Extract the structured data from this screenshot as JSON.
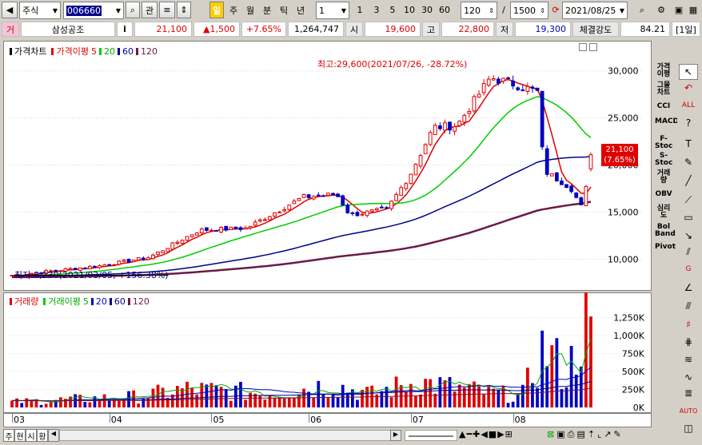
{
  "toolbar": {
    "market": "주식",
    "code": "006660",
    "btn_gwan": "관",
    "period_day": "일",
    "period_week": "주",
    "period_month": "월",
    "period_min": "분",
    "period_tick": "틱",
    "period_year": "년",
    "interval": "1",
    "quick_1": "1",
    "quick_3": "3",
    "quick_5": "5",
    "quick_10": "10",
    "quick_30": "30",
    "quick_60": "60",
    "count": "120",
    "slash": "/",
    "total": "1500",
    "date": "2021/08/25"
  },
  "quote": {
    "tag": "거",
    "name": "삼성공조",
    "info": "i",
    "price": "21,100",
    "change": "▲1,500",
    "rate": "+7.65%",
    "volume": "1,264,747",
    "open_label": "시",
    "open": "19,600",
    "high_label": "고",
    "high": "22,800",
    "low_label": "저",
    "low": "19,300",
    "strength_label": "체결강도",
    "strength": "84.21",
    "period_badge": "[1일]"
  },
  "price_legend": {
    "price": "가격차트",
    "ma_label": "가격이평",
    "ma5": "5",
    "ma20": "20",
    "ma60": "60",
    "ma120": "120"
  },
  "volume_legend": {
    "volume": "거래량",
    "ma_label": "거래이평",
    "ma5": "5",
    "ma20": "20",
    "ma60": "60",
    "ma120": "120"
  },
  "annotations": {
    "high": "최고:29,600(2021/07/26, -28.72%)",
    "low": "최저:8,230(2021/03/05, +156.38%)",
    "current_price": "21,100",
    "current_rate": "(7.65%)"
  },
  "price_axis": [
    "30,000",
    "25,000",
    "20,000",
    "15,000",
    "10,000"
  ],
  "volume_axis": [
    "1,250K",
    "1,000K",
    "750K",
    "500K",
    "250K",
    "0K"
  ],
  "months": [
    "03",
    "04",
    "05",
    "06",
    "07",
    "08"
  ],
  "indicators": [
    "가격이평",
    "그물차트",
    "CCI",
    "MACD",
    "F-Stoc",
    "S-Stoc",
    "거래량",
    "OBV",
    "심리도",
    "Bol Band",
    "Pivot"
  ],
  "bottom_tabs": [
    "주",
    "현",
    "시",
    "황"
  ],
  "colors": {
    "up": "#e00000",
    "down": "#0000c0",
    "ma5": "#e00000",
    "ma20": "#00cc00",
    "ma60": "#00008b",
    "ma120": "#6b1a45"
  },
  "chart_data": {
    "type": "candlestick",
    "title": "삼성공조",
    "y_range": [
      7500,
      31500
    ],
    "x_months": [
      "03",
      "04",
      "05",
      "06",
      "07",
      "08"
    ],
    "price_anchors": [
      {
        "date": "2021-03-05",
        "close": 8300
      },
      {
        "date": "2021-03-31",
        "close": 9300
      },
      {
        "date": "2021-04-15",
        "close": 10200
      },
      {
        "date": "2021-04-30",
        "close": 13100
      },
      {
        "date": "2021-05-14",
        "close": 13300
      },
      {
        "date": "2021-05-31",
        "close": 16600
      },
      {
        "date": "2021-06-10",
        "close": 16900
      },
      {
        "date": "2021-06-14",
        "close": 14700
      },
      {
        "date": "2021-06-25",
        "close": 15300
      },
      {
        "date": "2021-07-02",
        "close": 19000
      },
      {
        "date": "2021-07-09",
        "close": 24000
      },
      {
        "date": "2021-07-16",
        "close": 24200
      },
      {
        "date": "2021-07-26",
        "close": 29300
      },
      {
        "date": "2021-08-02",
        "close": 28600
      },
      {
        "date": "2021-08-09",
        "close": 27800
      },
      {
        "date": "2021-08-11",
        "close": 19400
      },
      {
        "date": "2021-08-19",
        "close": 17600
      },
      {
        "date": "2021-08-23",
        "close": 15000
      },
      {
        "date": "2021-08-24",
        "close": 19600
      },
      {
        "date": "2021-08-25",
        "close": 21100
      }
    ],
    "volume_range": [
      0,
      1400000
    ],
    "volume_anchors": [
      {
        "date": "2021-03",
        "volume": 90000
      },
      {
        "date": "2021-04-10",
        "volume": 300000
      },
      {
        "date": "2021-05-15",
        "volume": 250000
      },
      {
        "date": "2021-06-11",
        "volume": 400000
      },
      {
        "date": "2021-07-05",
        "volume": 420000
      },
      {
        "date": "2021-07-08",
        "volume": 460000
      },
      {
        "date": "2021-08-10",
        "volume": 1000000
      },
      {
        "date": "2021-08-24",
        "volume": 1380000
      },
      {
        "date": "2021-08-25",
        "volume": 1264747
      }
    ]
  }
}
